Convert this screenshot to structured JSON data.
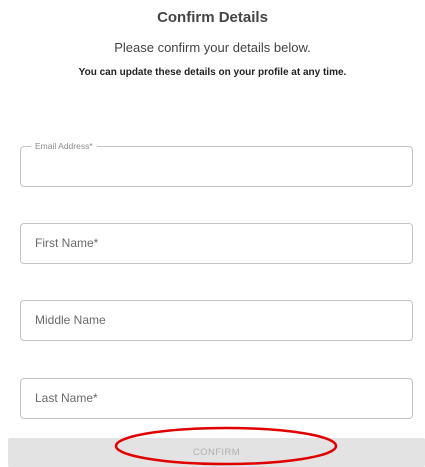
{
  "header": {
    "title": "Confirm Details",
    "subtitle": "Please confirm your details below.",
    "note": "You can update these details on your profile at any time."
  },
  "form": {
    "email": {
      "label": "Email Address*",
      "value": ""
    },
    "first_name": {
      "placeholder": "First Name*"
    },
    "middle_name": {
      "placeholder": "Middle Name"
    },
    "last_name": {
      "placeholder": "Last Name*"
    },
    "confirm_label": "CONFIRM"
  },
  "colors": {
    "button_background": "#e3e3e3",
    "button_text": "#b0b0b0",
    "annotation_circle": "#e00000",
    "field_border": "#c4c4c4"
  }
}
